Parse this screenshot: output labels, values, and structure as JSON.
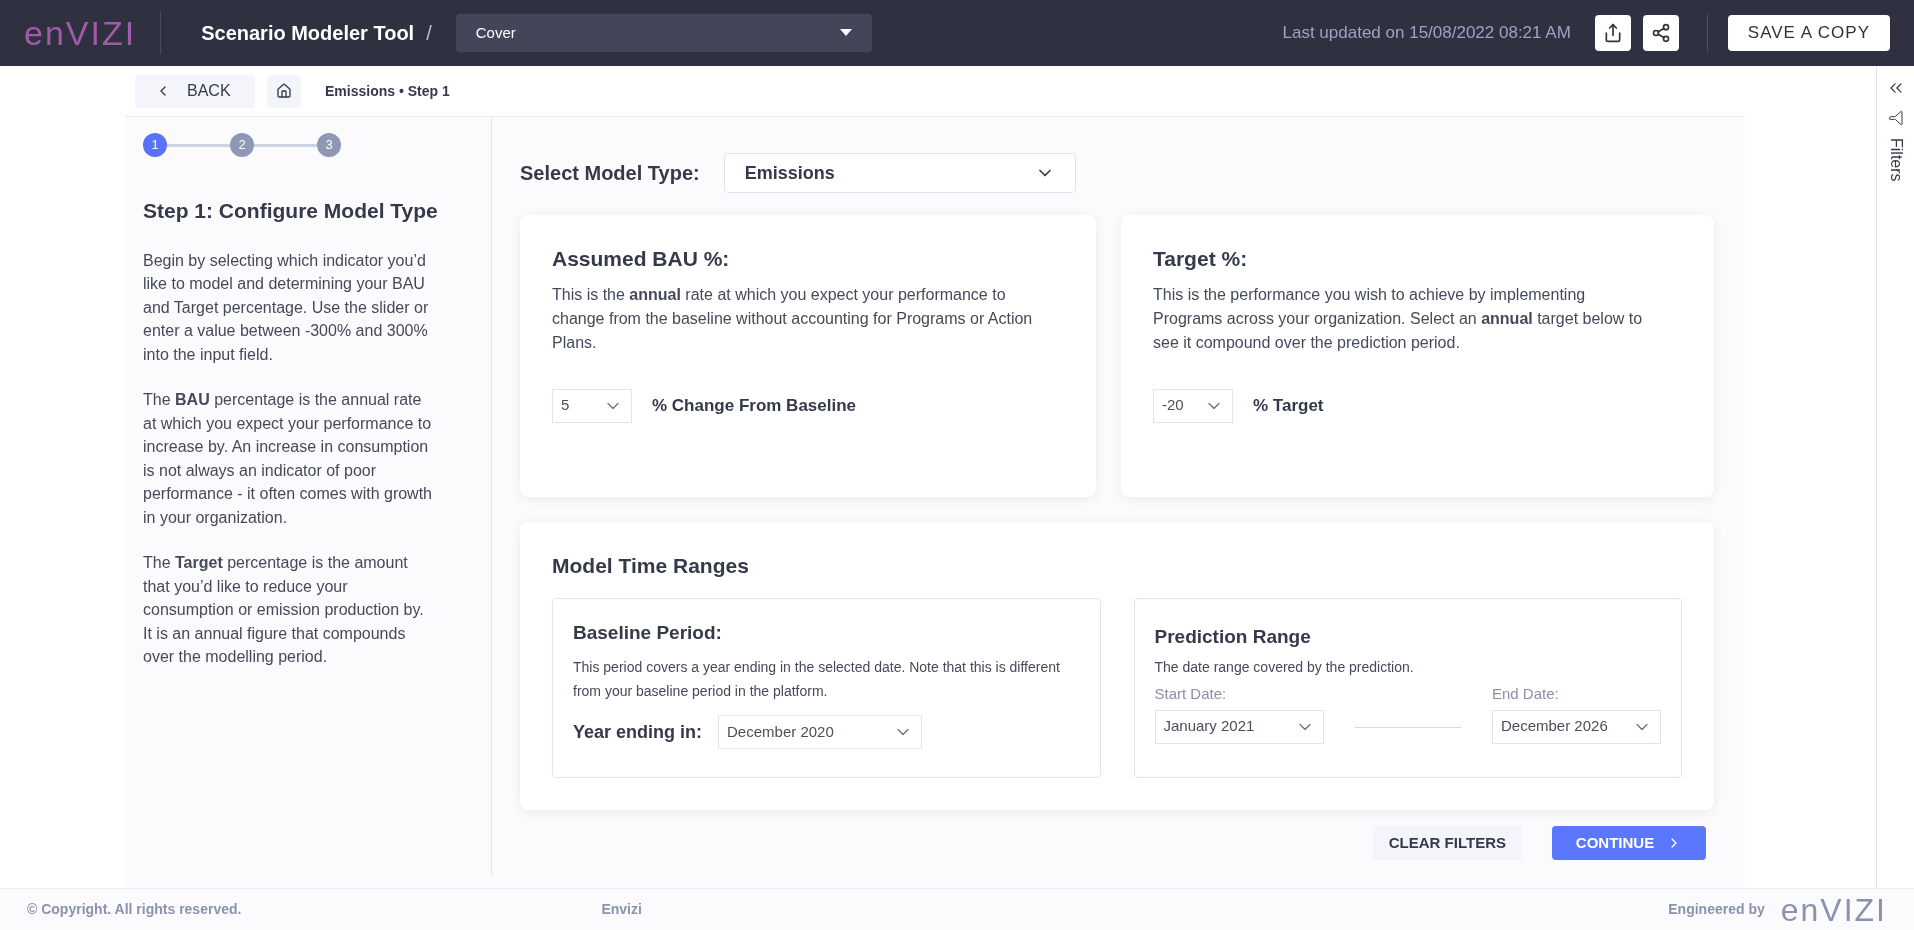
{
  "header": {
    "logo": "enVIZI",
    "title": "Scenario Modeler Tool",
    "separator": "/",
    "page_select": {
      "value": "Cover"
    },
    "last_updated": "Last updated on 15/08/2022 08:21 AM",
    "save_button": "SAVE A COPY"
  },
  "nav": {
    "back": "BACK",
    "breadcrumb": "Emissions • Step 1"
  },
  "stepper": [
    {
      "label": "1",
      "selected": true
    },
    {
      "label": "2",
      "selected": false
    },
    {
      "label": "3",
      "selected": false
    }
  ],
  "guide": {
    "title": "Step 1: Configure Model Type",
    "paragraphs": [
      "Begin by selecting which indicator you’d like to model and determining your BAU and Target percentage. Use the slider or enter a value between -300% and 300% into the input field.",
      "The **BAU** percentage is the annual rate at which you expect your performance to increase by. An increase in consumption is not always an indicator of poor performance - it often comes with growth in your organization.",
      "The **Target** percentage is the amount that you’d like to reduce your consumption or emission production by. It is an annual figure that compounds over the modelling period."
    ]
  },
  "model_type": {
    "label": "Select Model Type:",
    "value": "Emissions"
  },
  "cards": [
    {
      "title": "Assumed BAU %:",
      "text": "This is the **annual** rate at which you expect your performance to change from the baseline without accounting for Programs or Action Plans.",
      "value": "5",
      "unit": "% Change From Baseline"
    },
    {
      "title": "Target %:",
      "text": "This is the performance you wish to achieve by implementing Programs across your organization. Select an **annual** target below to see it compound over the prediction period.",
      "value": "-20",
      "unit": "% Target"
    }
  ],
  "time_ranges": {
    "title": "Model Time Ranges",
    "baseline": {
      "title": "Baseline Period:",
      "text": "This period covers a year ending in the selected date. Note that this is different from your baseline period in the platform.",
      "label": "Year ending in:",
      "value": "December 2020"
    },
    "prediction": {
      "title": "Prediction Range",
      "text": "The date range covered by the prediction.",
      "start_label": "Start Date:",
      "start_value": "January 2021",
      "end_label": "End Date:",
      "end_value": "December 2026"
    }
  },
  "actions": {
    "clear": "CLEAR FILTERS",
    "continue": "CONTINUE"
  },
  "filters_label": "Filters",
  "footer": {
    "copyright": "© Copyright. All rights reserved.",
    "center": "Envizi",
    "engineered": "Engineered by",
    "logo": "enVIZI"
  }
}
